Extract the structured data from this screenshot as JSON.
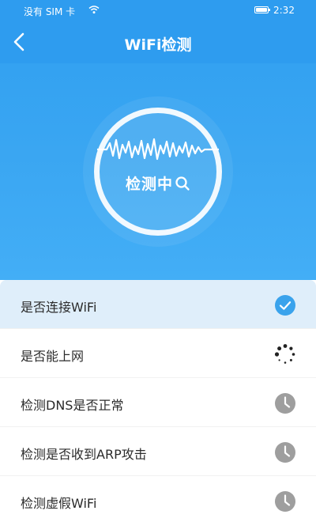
{
  "status_bar": {
    "carrier": "没有 SIM 卡",
    "time": "2:32",
    "icons": [
      "sim-card-icon",
      "wifi-signal-icon",
      "battery-icon"
    ]
  },
  "header": {
    "title": "WiFi检测",
    "back_icon": "chevron-left-icon"
  },
  "scanner": {
    "label": "检测中",
    "icon": "search-icon"
  },
  "checks": [
    {
      "label": "是否连接WiFi",
      "status": "done",
      "icon": "check-circle-icon"
    },
    {
      "label": "是否能上网",
      "status": "loading",
      "icon": "spinner-icon"
    },
    {
      "label": "检测DNS是否正常",
      "status": "pending",
      "icon": "clock-icon"
    },
    {
      "label": "检测是否收到ARP攻击",
      "status": "pending",
      "icon": "clock-icon"
    },
    {
      "label": "检测虚假WiFi",
      "status": "pending",
      "icon": "clock-icon"
    }
  ],
  "colors": {
    "header_blue": "#2f9ff0",
    "accent_blue": "#3aa3ec",
    "active_row_bg": "#dfeefa",
    "pending_gray": "#9e9e9e"
  }
}
